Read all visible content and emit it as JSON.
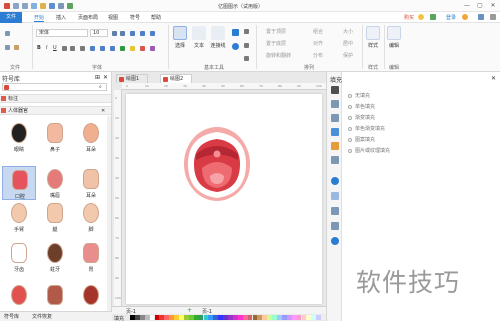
{
  "window": {
    "title": "亿图图示（试用版）",
    "controls": [
      "—",
      "▢",
      "✕"
    ]
  },
  "menubar": {
    "file": "文件",
    "items": [
      "开始",
      "插入",
      "页面布局",
      "视图",
      "符号",
      "帮助"
    ],
    "right": {
      "buy": "购买",
      "login": "登录"
    }
  },
  "ribbon": {
    "groups": [
      "文件",
      "字体",
      "基本工具",
      "排列",
      "样式",
      "编辑"
    ],
    "font_name": "宋体",
    "font_size": "10",
    "tools": {
      "select": "选择",
      "text": "文本",
      "connector": "连接线"
    },
    "arrange": [
      "置于顶层",
      "置于底层",
      "组合",
      "对齐",
      "旋转和翻转",
      "居中",
      "分布",
      "大小",
      "保护"
    ],
    "style_btn": "样式",
    "edit_btn": "编辑"
  },
  "library": {
    "title": "符号库",
    "section_mark": "标注",
    "section_body": "人体器官",
    "items": [
      {
        "label": "眼睛",
        "color": "#222222"
      },
      {
        "label": "鼻子",
        "color": "#f2b9a0"
      },
      {
        "label": "耳朵",
        "color": "#f0b08f"
      },
      {
        "label": "口腔",
        "color": "#e5545c"
      },
      {
        "label": "嘴唇",
        "color": "#e47a7a"
      },
      {
        "label": "耳朵",
        "color": "#f0c2a8"
      },
      {
        "label": "手臂",
        "color": "#f3c9ad"
      },
      {
        "label": "腿",
        "color": "#f3c9ad"
      },
      {
        "label": "脚",
        "color": "#f3c9ad"
      },
      {
        "label": "牙齿",
        "color": "#ffffff"
      },
      {
        "label": "蛀牙",
        "color": "#6b3f2a"
      },
      {
        "label": "胃",
        "color": "#e98d8d"
      },
      {
        "label": "",
        "color": "#e0514f"
      },
      {
        "label": "",
        "color": "#b25a4a"
      },
      {
        "label": "",
        "color": "#a5352b"
      }
    ],
    "bottom_tabs": [
      "符号库",
      "文件恢复"
    ]
  },
  "tabs": [
    {
      "label": "绘图1"
    },
    {
      "label": "绘图2"
    }
  ],
  "pagebar": {
    "page": "页-1",
    "add": "+",
    "page2": "页-1"
  },
  "colorbar_label": "填充",
  "fill_panel": {
    "title": "填充",
    "options": [
      "无填充",
      "单色填充",
      "渐变填充",
      "单色渐变填充",
      "图案填充",
      "图片或纹理填充"
    ]
  },
  "watermark": "软件技巧"
}
